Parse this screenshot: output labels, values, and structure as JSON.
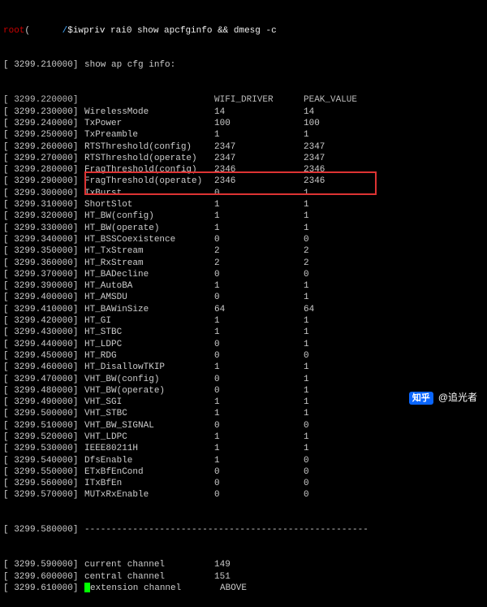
{
  "prompt": {
    "user": "root",
    "host": "(",
    "path": "/",
    "command": "$iwpriv rai0 show apcfginfo && dmesg -c"
  },
  "info_line": {
    "ts": "[ 3299.210000]",
    "text": "show ap cfg info:"
  },
  "table_header": {
    "ts": "[ 3299.220000]",
    "param": "",
    "col1": "WIFI_DRIVER",
    "col2": "PEAK_VALUE"
  },
  "rows": [
    {
      "ts": "[ 3299.230000]",
      "param": "WirelessMode",
      "col1": "14",
      "col2": "14"
    },
    {
      "ts": "[ 3299.240000]",
      "param": "TxPower",
      "col1": "100",
      "col2": "100"
    },
    {
      "ts": "[ 3299.250000]",
      "param": "TxPreamble",
      "col1": "1",
      "col2": "1"
    },
    {
      "ts": "[ 3299.260000]",
      "param": "RTSThreshold(config)",
      "col1": "2347",
      "col2": "2347"
    },
    {
      "ts": "[ 3299.270000]",
      "param": "RTSThreshold(operate)",
      "col1": "2347",
      "col2": "2347"
    },
    {
      "ts": "[ 3299.280000]",
      "param": "FragThreshold(config)",
      "col1": "2346",
      "col2": "2346"
    },
    {
      "ts": "[ 3299.290000]",
      "param": "FragThreshold(operate)",
      "col1": "2346",
      "col2": "2346"
    },
    {
      "ts": "[ 3299.300000]",
      "param": "TxBurst",
      "col1": "0",
      "col2": "1"
    },
    {
      "ts": "[ 3299.310000]",
      "param": "ShortSlot",
      "col1": "1",
      "col2": "1"
    },
    {
      "ts": "[ 3299.320000]",
      "param": "HT_BW(config)",
      "col1": "1",
      "col2": "1"
    },
    {
      "ts": "[ 3299.330000]",
      "param": "HT_BW(operate)",
      "col1": "1",
      "col2": "1"
    },
    {
      "ts": "[ 3299.340000]",
      "param": "HT_BSSCoexistence",
      "col1": "0",
      "col2": "0"
    },
    {
      "ts": "[ 3299.350000]",
      "param": "HT_TxStream",
      "col1": "2",
      "col2": "2"
    },
    {
      "ts": "[ 3299.360000]",
      "param": "HT_RxStream",
      "col1": "2",
      "col2": "2"
    },
    {
      "ts": "[ 3299.370000]",
      "param": "HT_BADecline",
      "col1": "0",
      "col2": "0"
    },
    {
      "ts": "[ 3299.390000]",
      "param": "HT_AutoBA",
      "col1": "1",
      "col2": "1"
    },
    {
      "ts": "[ 3299.400000]",
      "param": "HT_AMSDU",
      "col1": "0",
      "col2": "1"
    },
    {
      "ts": "[ 3299.410000]",
      "param": "HT_BAWinSize",
      "col1": "64",
      "col2": "64"
    },
    {
      "ts": "[ 3299.420000]",
      "param": "HT_GI",
      "col1": "1",
      "col2": "1"
    },
    {
      "ts": "[ 3299.430000]",
      "param": "HT_STBC",
      "col1": "1",
      "col2": "1"
    },
    {
      "ts": "[ 3299.440000]",
      "param": "HT_LDPC",
      "col1": "0",
      "col2": "1"
    },
    {
      "ts": "[ 3299.450000]",
      "param": "HT_RDG",
      "col1": "0",
      "col2": "0"
    },
    {
      "ts": "[ 3299.460000]",
      "param": "HT_DisallowTKIP",
      "col1": "1",
      "col2": "1"
    },
    {
      "ts": "[ 3299.470000]",
      "param": "VHT_BW(config)",
      "col1": "0",
      "col2": "1"
    },
    {
      "ts": "[ 3299.480000]",
      "param": "VHT_BW(operate)",
      "col1": "0",
      "col2": "1"
    },
    {
      "ts": "[ 3299.490000]",
      "param": "VHT_SGI",
      "col1": "1",
      "col2": "1"
    },
    {
      "ts": "[ 3299.500000]",
      "param": "VHT_STBC",
      "col1": "1",
      "col2": "1"
    },
    {
      "ts": "[ 3299.510000]",
      "param": "VHT_BW_SIGNAL",
      "col1": "0",
      "col2": "0"
    },
    {
      "ts": "[ 3299.520000]",
      "param": "VHT_LDPC",
      "col1": "1",
      "col2": "1"
    },
    {
      "ts": "[ 3299.530000]",
      "param": "IEEE80211H",
      "col1": "1",
      "col2": "1"
    },
    {
      "ts": "[ 3299.540000]",
      "param": "DfsEnable",
      "col1": "1",
      "col2": "0"
    },
    {
      "ts": "[ 3299.550000]",
      "param": "ETxBfEnCond",
      "col1": "0",
      "col2": "0"
    },
    {
      "ts": "[ 3299.560000]",
      "param": "ITxBfEn",
      "col1": "0",
      "col2": "0"
    },
    {
      "ts": "[ 3299.570000]",
      "param": "MUTxRxEnable",
      "col1": "0",
      "col2": "0"
    }
  ],
  "separator": {
    "ts": "[ 3299.580000]",
    "text": "-----------------------------------------------------"
  },
  "channels": [
    {
      "ts": "[ 3299.590000]",
      "param": "current channel",
      "col1": "149",
      "col2": ""
    },
    {
      "ts": "[ 3299.600000]",
      "param": "central channel",
      "col1": "151",
      "col2": ""
    },
    {
      "ts": "[ 3299.610000]",
      "param": "extension channel",
      "col1": "ABOVE",
      "col2": ""
    }
  ],
  "watermark": {
    "brand": "知乎",
    "user": "@追光者"
  }
}
